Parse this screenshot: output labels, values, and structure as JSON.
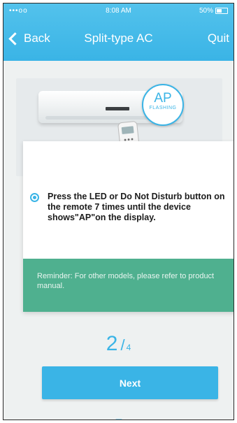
{
  "statusbar": {
    "carrier": "•••oo",
    "time": "8:08 AM",
    "battery": "50%"
  },
  "navbar": {
    "back_label": "Back",
    "title": "Split-type AC",
    "quit_label": "Quit"
  },
  "illustration": {
    "badge_main": "AP",
    "badge_sub": "FLASHING"
  },
  "instruction": {
    "text": "Press the LED or Do Not Disturb button on the remote 7 times until the device shows\"AP\"on the display."
  },
  "reminder": {
    "text": "Reminder: For other models, please refer to product manual."
  },
  "step": {
    "current": "2",
    "separator": "/",
    "total": "4"
  },
  "next_button": {
    "label": "Next"
  },
  "colors": {
    "accent": "#3ab4e6",
    "reminder_bg": "#4fb08f"
  }
}
